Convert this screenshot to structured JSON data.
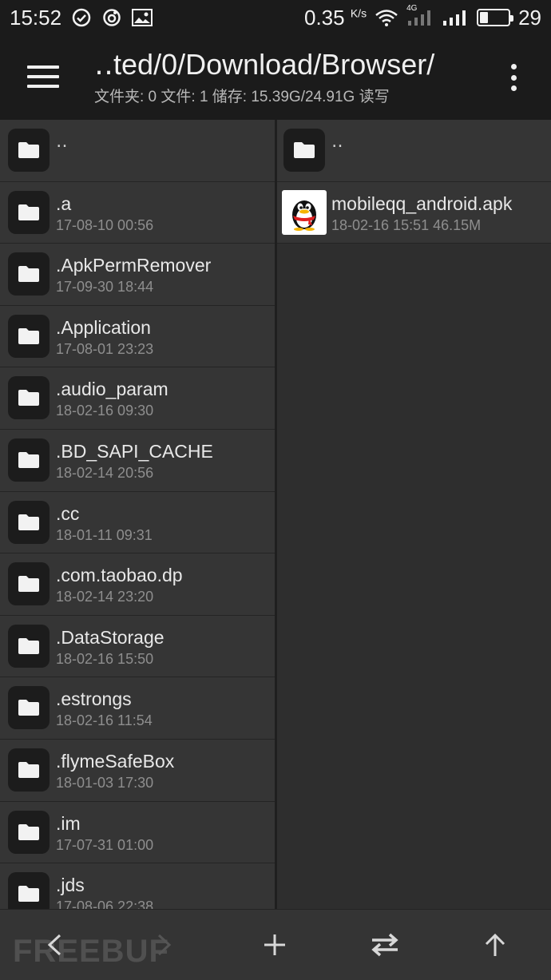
{
  "status_bar": {
    "time": "15:52",
    "net_speed": "0.35",
    "net_unit": "K/s",
    "network_type": "4G",
    "battery_level": "29",
    "battery_fraction": 0.29,
    "icons": [
      "check-circle-icon",
      "sync-icon",
      "gallery-icon",
      "wifi-icon",
      "signal-4g-icon",
      "signal-icon",
      "battery-icon"
    ]
  },
  "toolbar": {
    "path_title": "‥ted/0/Download/Browser/",
    "path_info": "文件夹: 0  文件: 1  储存: 15.39G/24.91G  读写"
  },
  "left_pane": {
    "parent_label": "‥",
    "items": [
      {
        "name": ".a",
        "date": "17-08-10 00:56"
      },
      {
        "name": ".ApkPermRemover",
        "date": "17-09-30 18:44"
      },
      {
        "name": ".Application",
        "date": "17-08-01 23:23"
      },
      {
        "name": ".audio_param",
        "date": "18-02-16 09:30"
      },
      {
        "name": ".BD_SAPI_CACHE",
        "date": "18-02-14 20:56"
      },
      {
        "name": ".cc",
        "date": "18-01-11 09:31"
      },
      {
        "name": ".com.taobao.dp",
        "date": "18-02-14 23:20"
      },
      {
        "name": ".DataStorage",
        "date": "18-02-16 15:50"
      },
      {
        "name": ".estrongs",
        "date": "18-02-16 11:54"
      },
      {
        "name": ".flymeSafeBox",
        "date": "18-01-03 17:30"
      },
      {
        "name": ".im",
        "date": "17-07-31 01:00"
      },
      {
        "name": ".jds",
        "date": "17-08-06 22:38"
      }
    ]
  },
  "right_pane": {
    "parent_label": "‥",
    "items": [
      {
        "name": "mobileqq_android.apk",
        "meta": "18-02-16 15:51  46.15M"
      }
    ]
  },
  "bottom_bar": {
    "watermark": "FREEBUF",
    "buttons": [
      "back-arrow-icon",
      "forward-arrow-icon",
      "add-icon",
      "swap-icon",
      "up-arrow-icon"
    ]
  }
}
